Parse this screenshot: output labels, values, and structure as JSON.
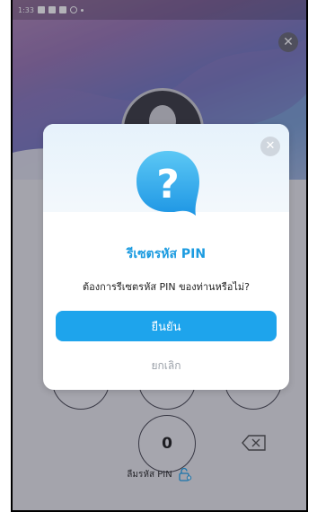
{
  "status_bar": {
    "time": "1:33"
  },
  "keypad": {
    "zero": "0"
  },
  "forgot_pin": {
    "label": "ลืมรหัส PIN"
  },
  "dialog": {
    "title": "รีเซตรหัส PIN",
    "message": "ต้องการรีเซตรหัส PIN ของท่านหรือไม่?",
    "confirm_label": "ยืนยัน",
    "cancel_label": "ยกเลิก",
    "icon": "question-mark-icon"
  },
  "colors": {
    "accent": "#1ea4ec",
    "title": "#1b9be0"
  }
}
